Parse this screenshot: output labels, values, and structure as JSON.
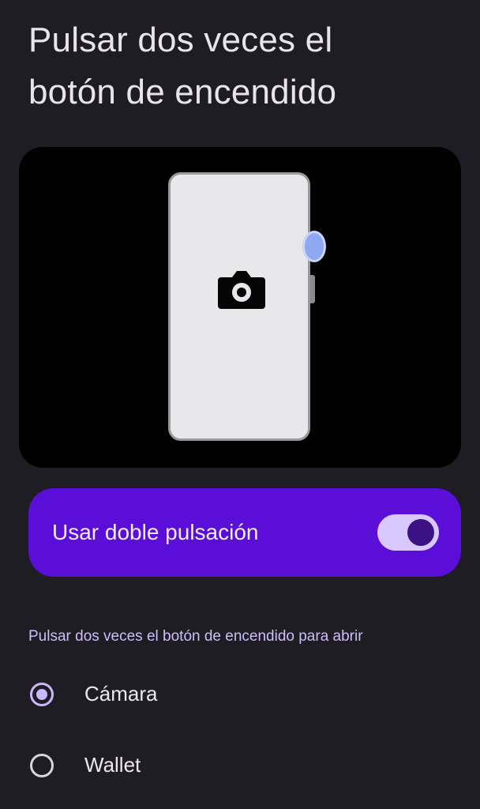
{
  "header": {
    "title_line1": "Pulsar dos veces el",
    "title_line2": "botón de encendido"
  },
  "illustration": {
    "icon": "camera-icon",
    "accent_color": "#8fa8f2"
  },
  "toggle": {
    "label": "Usar doble pulsación",
    "state": "on",
    "card_color": "#5a0ed8"
  },
  "options": {
    "section_title": "Pulsar dos veces el botón de encendido para abrir",
    "items": [
      {
        "label": "Cámara",
        "selected": true
      },
      {
        "label": "Wallet",
        "selected": false
      }
    ]
  }
}
